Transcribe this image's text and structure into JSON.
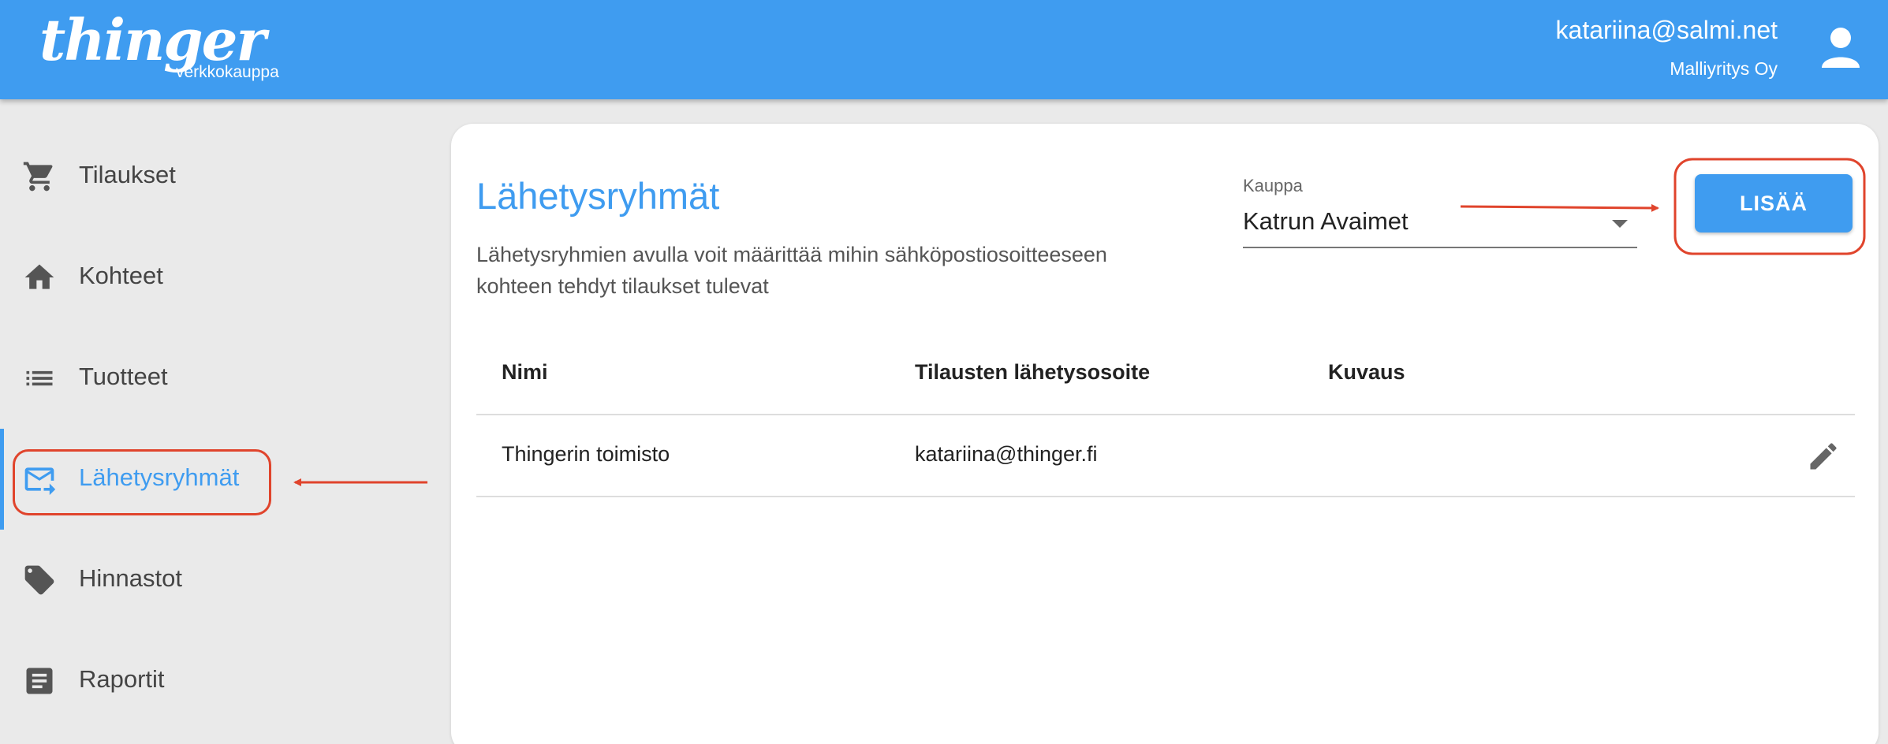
{
  "header": {
    "logo_text": "thinger",
    "logo_subtext": "verkkokauppa",
    "user_email": "katariina@salmi.net",
    "user_company": "Malliyritys Oy",
    "avatar_icon": "user-icon"
  },
  "sidebar": {
    "items": [
      {
        "label": "Tilaukset",
        "icon": "cart-icon"
      },
      {
        "label": "Kohteet",
        "icon": "home-icon"
      },
      {
        "label": "Tuotteet",
        "icon": "list-icon"
      },
      {
        "label": "Lähetysryhmät",
        "icon": "mail-forward-icon",
        "active": true
      },
      {
        "label": "Hinnastot",
        "icon": "tag-icon"
      },
      {
        "label": "Raportit",
        "icon": "report-icon"
      }
    ]
  },
  "main": {
    "title": "Lähetysryhmät",
    "description": "Lähetysryhmien avulla voit määrittää mihin sähköpostiosoitteeseen kohteen tehdyt tilaukset tulevat",
    "store_label": "Kauppa",
    "store_value": "Katrun Avaimet",
    "add_button": "LISÄÄ",
    "table": {
      "headers": [
        "Nimi",
        "Tilausten lähetysosoite",
        "Kuvaus"
      ],
      "rows": [
        {
          "name": "Thingerin toimisto",
          "email": "katariina@thinger.fi",
          "description": ""
        }
      ]
    }
  },
  "colors": {
    "primary": "#3f9cf0",
    "annotation": "#e0442c",
    "sidebar_bg": "#eaeaea"
  }
}
